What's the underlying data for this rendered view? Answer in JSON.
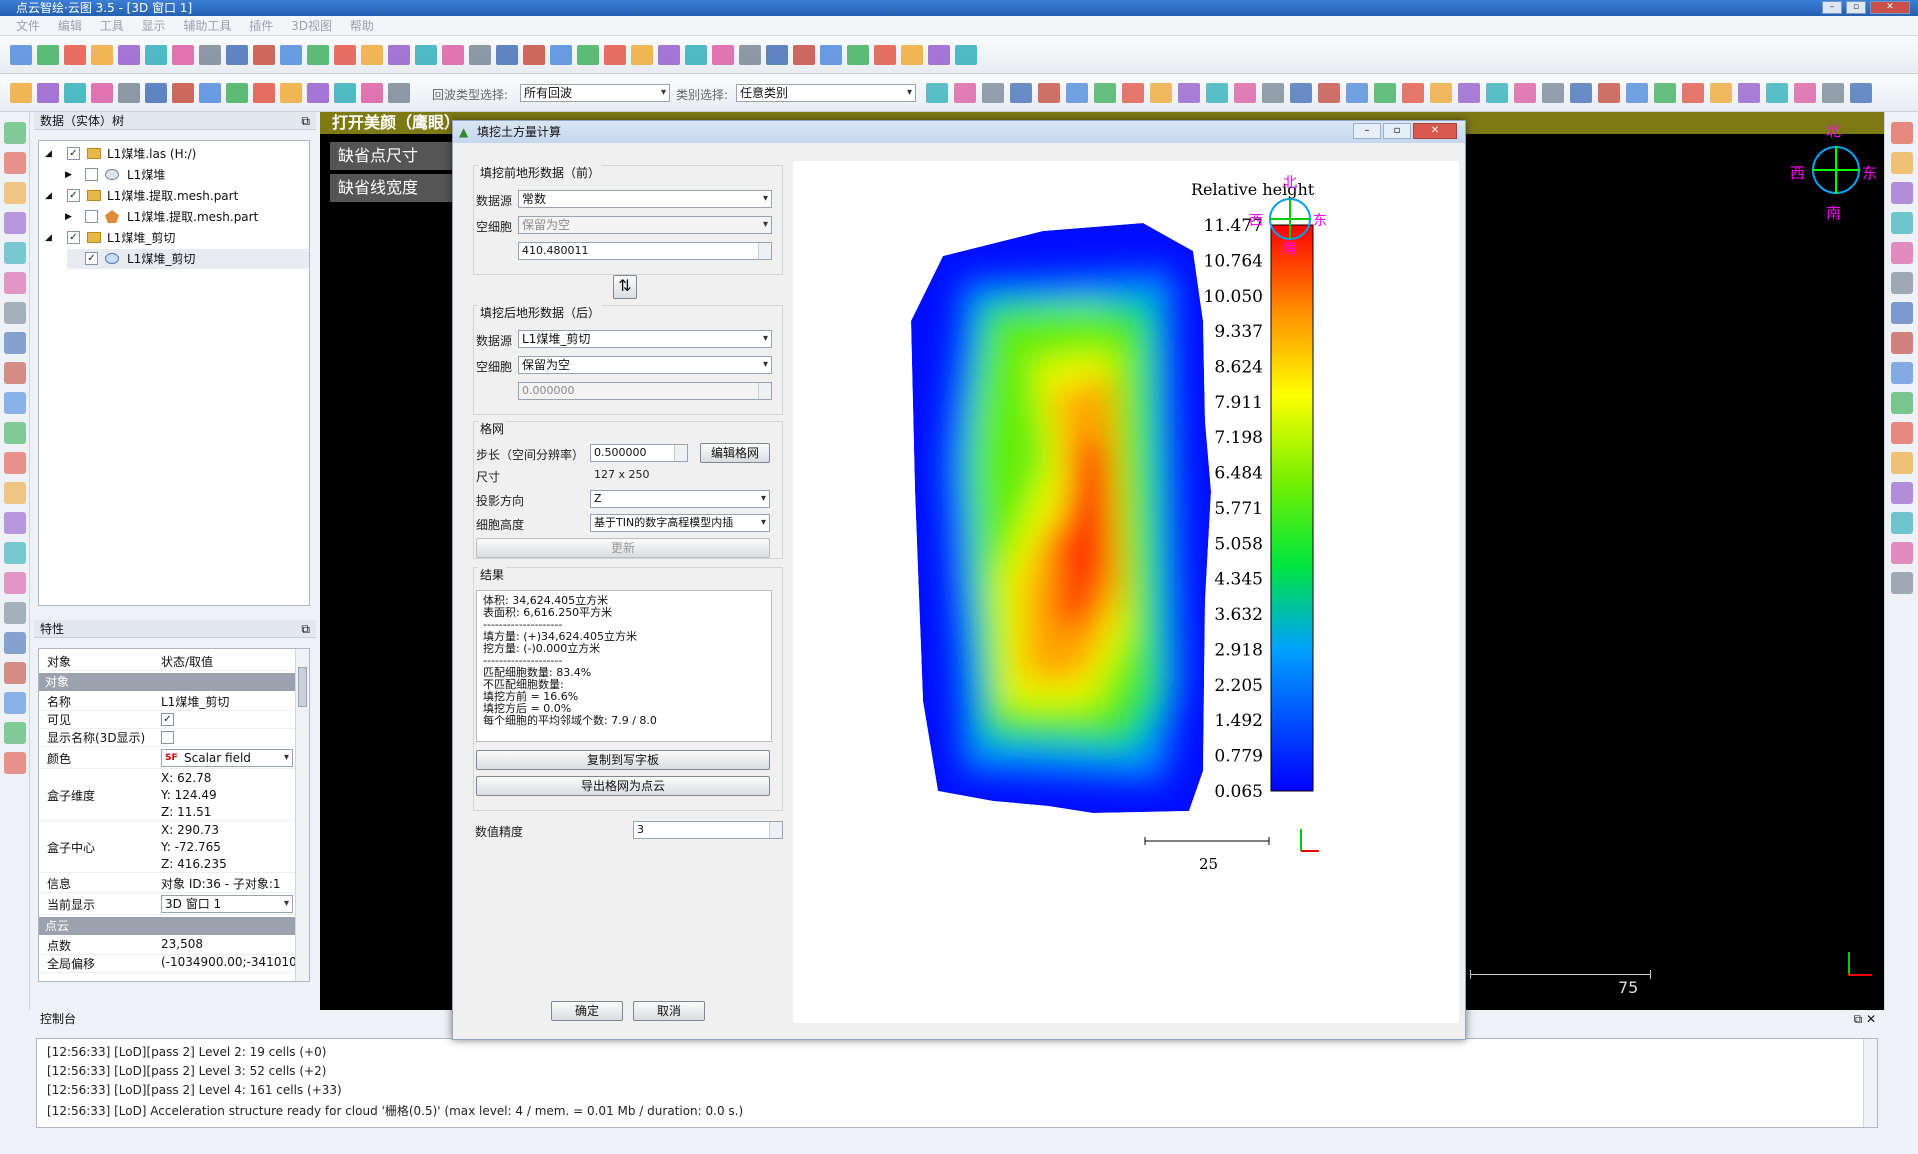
{
  "app": {
    "title": "点云智绘·云图 3.5 - [3D 窗口 1]",
    "menus": [
      "文件",
      "编辑",
      "工具",
      "显示",
      "辅助工具",
      "插件",
      "3D视图",
      "帮助"
    ]
  },
  "toolbar2": {
    "scan_type_label": "回波类型选择:",
    "scan_type_value": "所有回波",
    "class_label": "类别选择:",
    "class_value": "任意类别"
  },
  "tree_panel": {
    "title": "数据（实体）树",
    "items": [
      {
        "label": "L1煤堆.las (H:/)",
        "checked": "✓"
      },
      {
        "label": "L1煤堆",
        "checked": ""
      },
      {
        "label": "L1煤堆.提取.mesh.part",
        "checked": "✓"
      },
      {
        "label": "L1煤堆.提取.mesh.part",
        "checked": ""
      },
      {
        "label": "L1煤堆_剪切",
        "checked": "✓"
      },
      {
        "label": "L1煤堆_剪切",
        "checked": "✓"
      }
    ]
  },
  "props_panel": {
    "title": "特性",
    "col_key": "对象",
    "col_val": "状态/取值",
    "section_object": "对象",
    "name_k": "名称",
    "name_v": "L1煤堆_剪切",
    "visible_k": "可见",
    "visible_v": "✓",
    "showname_k": "显示名称(3D显示)",
    "color_k": "颜色",
    "color_v": "Scalar field",
    "box_dim_k": "盒子维度",
    "box_dim_x": "X: 62.78",
    "box_dim_y": "Y: 124.49",
    "box_dim_z": "Z: 11.51",
    "box_center_k": "盒子中心",
    "box_center_x": "X: 290.73",
    "box_center_y": "Y: -72.765",
    "box_center_z": "Z: 416.235",
    "info_k": "信息",
    "info_v": "对象 ID:36 - 子对象:1",
    "current_k": "当前显示",
    "current_v": "3D 窗口 1",
    "section_cloud": "点云",
    "points_k": "点数",
    "points_v": "23,508",
    "offset_k": "全局偏移",
    "offset_v": "(-1034900.00;-3410100"
  },
  "view3d": {
    "overlay_title": "打开美颜（鹰眼）",
    "default_point_size": "缺省点尺寸",
    "default_line_width": "缺省线宽度",
    "compass": {
      "n": "北",
      "s": "南",
      "w": "西",
      "e": "东"
    },
    "scale_label": "75"
  },
  "console": {
    "title": "控制台",
    "lines": [
      "[12:56:33] [LoD][pass 2] Level 2: 19 cells (+0)",
      "[12:56:33] [LoD][pass 2] Level 3: 52 cells (+2)",
      "[12:56:33] [LoD][pass 2] Level 4: 161 cells (+33)",
      "[12:56:33] [LoD] Acceleration structure ready for cloud '栅格(0.5)' (max level: 4 / mem. = 0.01 Mb / duration: 0.0 s.)"
    ]
  },
  "dialog": {
    "title": "填挖土方量计算",
    "before_group": "填挖前地形数据（前）",
    "before_source_label": "数据源",
    "before_source_value": "常数",
    "before_empty_label": "空细胞",
    "before_empty_value": "保留为空",
    "before_const_value": "410.480011",
    "after_group": "填挖后地形数据（后）",
    "after_source_label": "数据源",
    "after_source_value": "L1煤堆_剪切",
    "after_empty_label": "空细胞",
    "after_empty_value": "保留为空",
    "after_const_value": "0.000000",
    "grid_group": "格网",
    "step_label": "步长（空间分辨率）",
    "step_value": "0.500000",
    "edit_grid": "编辑格网",
    "size_label": "尺寸",
    "size_value": "127 x 250",
    "proj_label": "投影方向",
    "proj_value": "Z",
    "cell_height_label": "细胞高度",
    "cell_height_value": "基于TIN的数字高程模型内插",
    "update": "更新",
    "results_group": "结果",
    "results": [
      "体积:  34,624.405立方米",
      "表面积: 6,616.250平方米",
      "--------------------",
      "填方量:  (+)34,624.405立方米",
      "挖方量:  (-)0.000立方米",
      "--------------------",
      "匹配细胞数量:  83.4%",
      "不匹配细胞数量:",
      "填挖方前 = 16.6%",
      "填挖方后 = 0.0%",
      "每个细胞的平均邻域个数: 7.9 / 8.0"
    ],
    "copy_clipboard": "复制到写字板",
    "export_grid": "导出格网为点云",
    "precision_label": "数值精度",
    "precision_value": "3",
    "ok": "确定",
    "cancel": "取消"
  },
  "chart_data": {
    "type": "heatmap",
    "colorbar_title": "Relative height",
    "colorbar_ticks": [
      "11.477",
      "10.764",
      "10.050",
      "9.337",
      "8.624",
      "7.911",
      "7.198",
      "6.484",
      "5.771",
      "5.058",
      "4.345",
      "3.632",
      "2.918",
      "2.205",
      "1.492",
      "0.779",
      "0.065"
    ],
    "vmin": 0.065,
    "vmax": 11.477,
    "scale_bar_label": "25",
    "compass": {
      "n": "北",
      "s": "南",
      "w": "西",
      "e": "东"
    }
  }
}
